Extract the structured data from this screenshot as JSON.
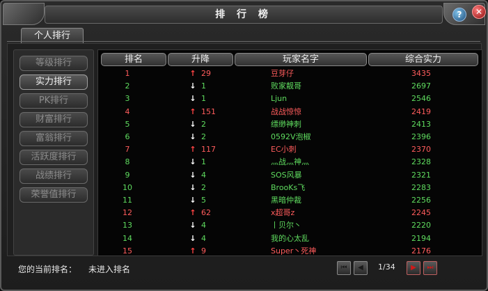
{
  "window": {
    "title": "排 行 榜",
    "help_label": "?",
    "close_label": "✕"
  },
  "tab": {
    "label": "个人排行"
  },
  "sidebar": {
    "items": [
      {
        "label": "等级排行",
        "active": false
      },
      {
        "label": "实力排行",
        "active": true
      },
      {
        "label": "PK排行",
        "active": false
      },
      {
        "label": "财富排行",
        "active": false
      },
      {
        "label": "富翁排行",
        "active": false
      },
      {
        "label": "活跃度排行",
        "active": false
      },
      {
        "label": "战绩排行",
        "active": false
      },
      {
        "label": "荣誉值排行",
        "active": false
      }
    ]
  },
  "table": {
    "headers": [
      "排名",
      "升降",
      "玩家名字",
      "综合实力"
    ],
    "rows": [
      {
        "rank": "1",
        "dir": "up",
        "arrow": "↑",
        "change": "29",
        "name": "豆芽仔",
        "power": "3435"
      },
      {
        "rank": "2",
        "dir": "down",
        "arrow": "↓",
        "change": "1",
        "name": "败家靓哥",
        "power": "2697"
      },
      {
        "rank": "3",
        "dir": "down",
        "arrow": "↓",
        "change": "1",
        "name": "Ljun",
        "power": "2546"
      },
      {
        "rank": "4",
        "dir": "up",
        "arrow": "↑",
        "change": "151",
        "name": "战战惊惊",
        "power": "2419"
      },
      {
        "rank": "5",
        "dir": "down",
        "arrow": "↓",
        "change": "2",
        "name": "缥缈神刺",
        "power": "2413"
      },
      {
        "rank": "6",
        "dir": "down",
        "arrow": "↓",
        "change": "2",
        "name": "0592V泡椒",
        "power": "2396"
      },
      {
        "rank": "7",
        "dir": "up",
        "arrow": "↑",
        "change": "117",
        "name": "EC小刺",
        "power": "2370"
      },
      {
        "rank": "8",
        "dir": "down",
        "arrow": "↓",
        "change": "1",
        "name": "灬战灬神灬",
        "power": "2328"
      },
      {
        "rank": "9",
        "dir": "down",
        "arrow": "↓",
        "change": "4",
        "name": "SOS风暴",
        "power": "2321"
      },
      {
        "rank": "10",
        "dir": "down",
        "arrow": "↓",
        "change": "2",
        "name": "BrooKs飞",
        "power": "2283"
      },
      {
        "rank": "11",
        "dir": "down",
        "arrow": "↓",
        "change": "5",
        "name": "黑暗仲裁",
        "power": "2256"
      },
      {
        "rank": "12",
        "dir": "up",
        "arrow": "↑",
        "change": "62",
        "name": "x超哥z",
        "power": "2245"
      },
      {
        "rank": "13",
        "dir": "down",
        "arrow": "↓",
        "change": "4",
        "name": "丨贝尔丶",
        "power": "2220"
      },
      {
        "rank": "14",
        "dir": "down",
        "arrow": "↓",
        "change": "4",
        "name": "我的心太乱",
        "power": "2194"
      },
      {
        "rank": "15",
        "dir": "up",
        "arrow": "↑",
        "change": "9",
        "name": "Super丶死神",
        "power": "2176"
      }
    ]
  },
  "footer": {
    "current_rank_label": "您的当前排名：",
    "current_rank_value": "未进入排名",
    "page_indicator": "1/34",
    "first_label": "⏮",
    "prev_label": "◀",
    "next_label": "▶",
    "last_label": "⏭"
  },
  "colors": {
    "up": "#ff5c5c",
    "down": "#5fdc5f"
  }
}
